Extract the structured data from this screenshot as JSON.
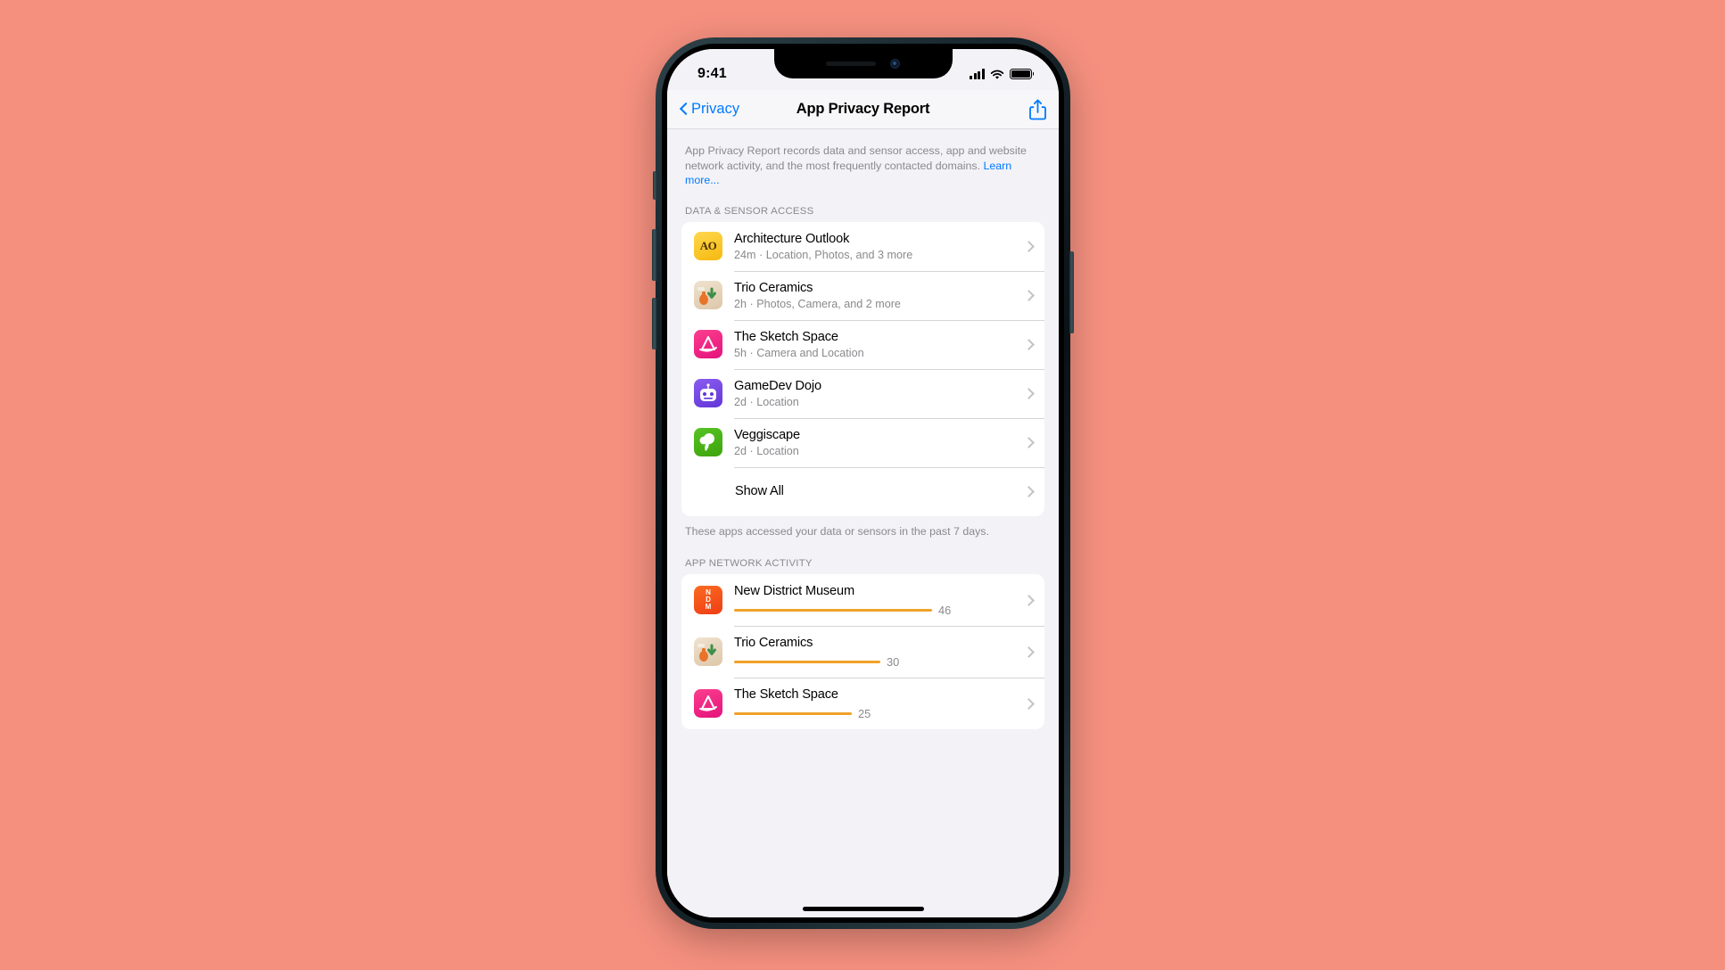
{
  "background_color": "#f5907f",
  "status_bar": {
    "time": "9:41",
    "cellular_icon": "cellular-bars-icon",
    "wifi_icon": "wifi-icon",
    "battery_icon": "battery-icon"
  },
  "nav": {
    "back_label": "Privacy",
    "back_icon": "chevron-left-icon",
    "title": "App Privacy Report",
    "share_icon": "share-icon"
  },
  "intro": {
    "text": "App Privacy Report records data and sensor access, app and website network activity, and the most frequently contacted domains. ",
    "link": "Learn more..."
  },
  "sections": [
    {
      "header": "DATA & SENSOR ACCESS",
      "footnote": "These apps accessed your data or sensors in the past 7 days.",
      "rows": [
        {
          "title": "Architecture Outlook",
          "subtitle": "24m · Location, Photos, and 3 more",
          "icon": "app-icon-architecture-outlook",
          "icon_color": "#f5b90f",
          "icon_text": "AO"
        },
        {
          "title": "Trio Ceramics",
          "subtitle": "2h · Photos, Camera, and 2 more",
          "icon": "app-icon-trio-ceramics",
          "icon_color": "#ddc7a8",
          "icon_text": ""
        },
        {
          "title": "The Sketch Space",
          "subtitle": "5h · Camera and Location",
          "icon": "app-icon-the-sketch-space",
          "icon_color": "#e5127c",
          "icon_text": ""
        },
        {
          "title": "GameDev Dojo",
          "subtitle": "2d · Location",
          "icon": "app-icon-gamedev-dojo",
          "icon_color": "#6236d8",
          "icon_text": ""
        },
        {
          "title": "Veggiscape",
          "subtitle": "2d · Location",
          "icon": "app-icon-veggiscape",
          "icon_color": "#3da30d",
          "icon_text": ""
        }
      ],
      "show_all_label": "Show All"
    },
    {
      "header": "APP NETWORK ACTIVITY",
      "bar_color": "#f0a22a",
      "rows": [
        {
          "title": "New District Museum",
          "value": "46",
          "bar_pct": 100,
          "icon": "app-icon-new-district-museum",
          "icon_color": "#ef3d14",
          "icon_text": "NDM"
        },
        {
          "title": "Trio Ceramics",
          "value": "30",
          "bar_pct": 66,
          "icon": "app-icon-trio-ceramics",
          "icon_color": "#ddc7a8",
          "icon_text": ""
        },
        {
          "title": "The Sketch Space",
          "value": "25",
          "bar_pct": 53,
          "icon": "app-icon-the-sketch-space",
          "icon_color": "#e5127c",
          "icon_text": ""
        }
      ]
    }
  ],
  "home_indicator": "home-indicator"
}
